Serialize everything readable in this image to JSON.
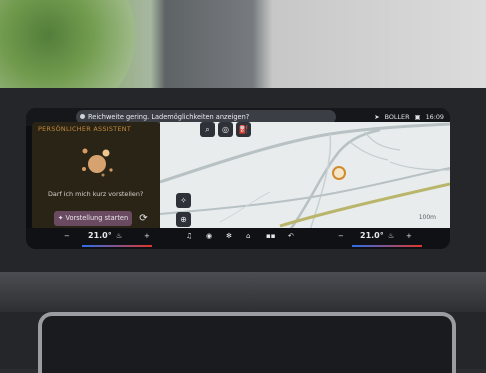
{
  "notification": {
    "text": "Reichweite gering. Lademöglichkeiten anzeigen?"
  },
  "status": {
    "location": "BOLLER",
    "time": "16:09"
  },
  "assistant": {
    "title": "PERSÖNLICHER ASSISTENT",
    "question": "Darf ich mich kurz vorstellen?",
    "start_button": "Vorstellung starten"
  },
  "map": {
    "scale": "100m"
  },
  "climate": {
    "left_temp": "21.0°",
    "right_temp": "21.0°",
    "minus": "−",
    "plus": "+"
  },
  "colors": {
    "accent": "#c58b3b",
    "button": "#6a4a60",
    "route": "#b9b56a"
  }
}
